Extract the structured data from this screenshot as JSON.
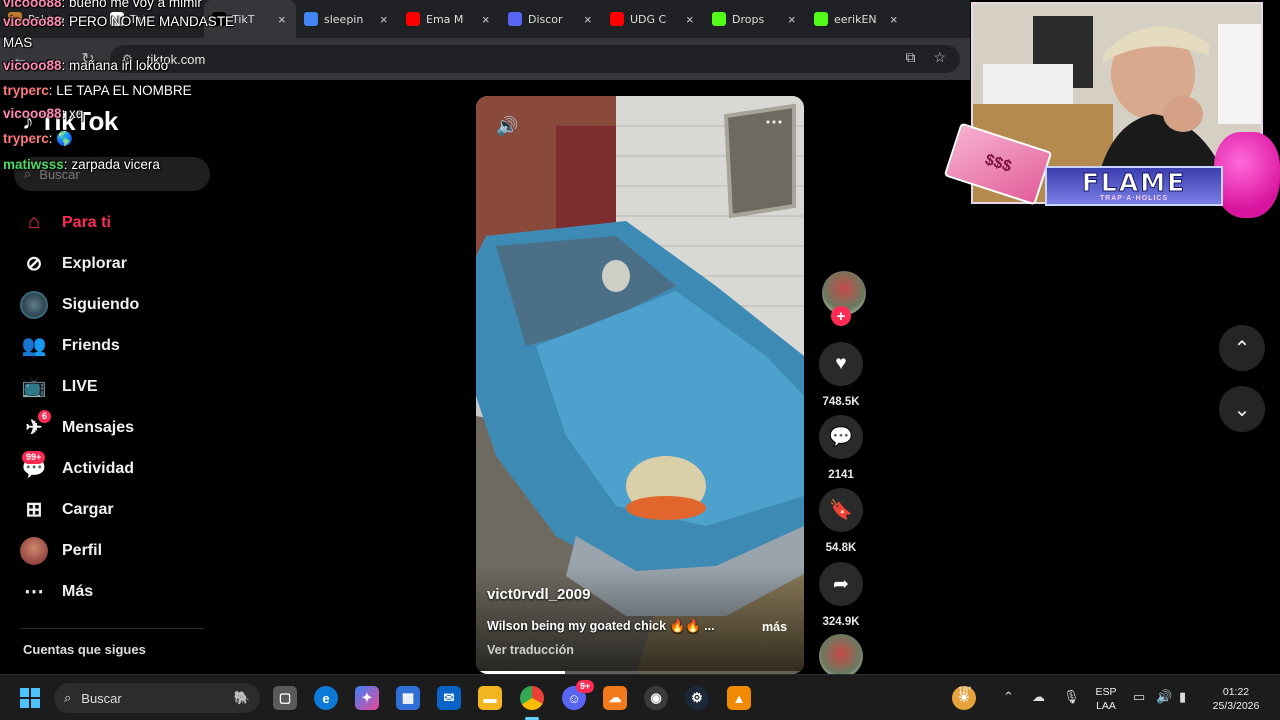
{
  "browser": {
    "tabs": [
      {
        "label": "Paldea",
        "favicon_color": "#c07a2a",
        "active": false
      },
      {
        "label": "Tok",
        "favicon_color": "#ffffff",
        "active": false
      },
      {
        "label": "TikT",
        "favicon_color": "#000000",
        "active": true
      },
      {
        "label": "sleepin",
        "favicon_color": "#4285f4",
        "active": false
      },
      {
        "label": "Ema M",
        "favicon_color": "#ff0000",
        "active": false
      },
      {
        "label": "Discor",
        "favicon_color": "#5865f2",
        "active": false
      },
      {
        "label": "UDG C",
        "favicon_color": "#ff0000",
        "active": false
      },
      {
        "label": "Drops",
        "favicon_color": "#53fc18",
        "active": false
      },
      {
        "label": "eerikEN",
        "favicon_color": "#53fc18",
        "active": false
      }
    ],
    "url": "tiktok.com",
    "close_symbol": "×"
  },
  "sidebar": {
    "logo_text": "TikTok",
    "search_placeholder": "Buscar",
    "items": [
      {
        "label": "Para ti",
        "icon": "home-icon",
        "active": true
      },
      {
        "label": "Explorar",
        "icon": "compass-icon"
      },
      {
        "label": "Siguiendo",
        "icon": "following-avatar-icon"
      },
      {
        "label": "Friends",
        "icon": "friends-icon"
      },
      {
        "label": "LIVE",
        "icon": "live-tv-icon"
      },
      {
        "label": "Mensajes",
        "icon": "messages-icon",
        "badge": "6"
      },
      {
        "label": "Actividad",
        "icon": "activity-icon",
        "badge": "99+"
      },
      {
        "label": "Cargar",
        "icon": "upload-icon"
      },
      {
        "label": "Perfil",
        "icon": "profile-avatar-icon"
      },
      {
        "label": "Más",
        "icon": "more-icon"
      }
    ],
    "following_heading": "Cuentas que sigues"
  },
  "video": {
    "author": "vict0rvdl_2009",
    "caption": "Wilson being my goated chick 🔥🔥 ...",
    "more_label": "más",
    "translate_label": "Ver traducción",
    "progress": 0.27
  },
  "actions": {
    "likes": "748.5K",
    "comments": "2141",
    "saves": "54.8K",
    "shares": "324.9K"
  },
  "overlay": {
    "chat": [
      {
        "user": "vicooo88",
        "message": "bueno me voy a mimir",
        "user_color": "#ff8ab5"
      },
      {
        "user": "vicooo88",
        "message": "PERO NO ME MANDASTE",
        "user_color": "#ff8ab5"
      },
      {
        "user": "",
        "message": "MAS",
        "user_color": "#ff8ab5"
      },
      {
        "user": "vicooo88",
        "message": "mañana irl lokoo",
        "user_color": "#ff8ab5"
      },
      {
        "user": "tryperc",
        "message": "LE TAPA EL NOMBRE",
        "user_color": "#ff7a7a"
      },
      {
        "user": "vicooo88",
        "message": "xq",
        "user_color": "#ff8ab5"
      },
      {
        "user": "tryperc",
        "message": "🌎",
        "user_color": "#ff7a7a"
      },
      {
        "user": "matiwsss",
        "message": "zarpada vicera",
        "user_color": "#4cd964"
      }
    ],
    "banner_title": "FLAME",
    "banner_subtitle": "TRAP·A·HOLICS"
  },
  "taskbar": {
    "search_label": "Buscar",
    "weather": "18°",
    "language_line1": "ESP",
    "language_line2": "LAA",
    "time": "01:22",
    "date": "25/3/2026",
    "discord_badge": "9+"
  },
  "colors": {
    "accent": "#fe2c55",
    "background": "#000000"
  }
}
